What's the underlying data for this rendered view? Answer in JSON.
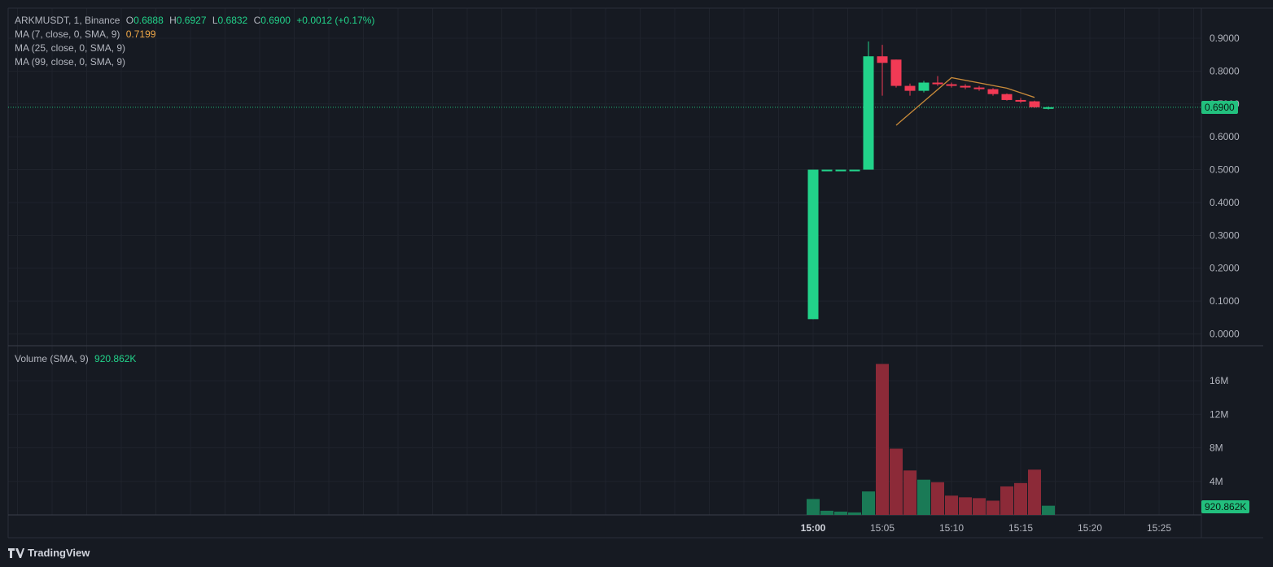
{
  "legend": {
    "symbol": "ARKMUSDT, 1, Binance",
    "o_label": "O",
    "o": "0.6888",
    "h_label": "H",
    "h": "0.6927",
    "l_label": "L",
    "l": "0.6832",
    "c_label": "C",
    "c": "0.6900",
    "change": "+0.0012 (+0.17%)",
    "ma7_label": "MA (7, close, 0, SMA, 9)",
    "ma7_value": "0.7199",
    "ma25_label": "MA (25, close, 0, SMA, 9)",
    "ma99_label": "MA (99, close, 0, SMA, 9)",
    "volume_label": "Volume (SMA, 9)",
    "volume_value": "920.862K"
  },
  "price_tag": "0.6900",
  "volume_tag": "920.862K",
  "brand": "TradingView",
  "colors": {
    "up": "#22d38a",
    "down": "#f23a55",
    "vol_up": "#1a7a56",
    "vol_down": "#8c2a38",
    "ma7": "#c98b3a",
    "bg": "#161a22"
  },
  "chart_data": {
    "type": "candlestick",
    "price_axis": {
      "ticks": [
        "0.9000",
        "0.8000",
        "0.7000",
        "0.6000",
        "0.5000",
        "0.4000",
        "0.3000",
        "0.2000",
        "0.1000",
        "0.0000"
      ],
      "ylim": [
        0,
        0.9
      ]
    },
    "volume_axis": {
      "ticks": [
        "16M",
        "12M",
        "8M",
        "4M"
      ],
      "unit": "M"
    },
    "time_axis": {
      "ticks": [
        "15:00",
        "15:05",
        "15:10",
        "15:15",
        "15:20",
        "15:25"
      ],
      "bold": "15:00"
    },
    "candles": [
      {
        "t": "15:00",
        "o": 0.045,
        "h": 0.5,
        "l": 0.045,
        "c": 0.5,
        "v": 1.9
      },
      {
        "t": "15:01",
        "o": 0.5,
        "h": 0.5,
        "l": 0.5,
        "c": 0.5,
        "v": 0.5
      },
      {
        "t": "15:02",
        "o": 0.5,
        "h": 0.5,
        "l": 0.5,
        "c": 0.5,
        "v": 0.4
      },
      {
        "t": "15:03",
        "o": 0.5,
        "h": 0.5,
        "l": 0.5,
        "c": 0.5,
        "v": 0.3
      },
      {
        "t": "15:04",
        "o": 0.5,
        "h": 0.89,
        "l": 0.5,
        "c": 0.845,
        "v": 2.8
      },
      {
        "t": "15:05",
        "o": 0.845,
        "h": 0.88,
        "l": 0.725,
        "c": 0.825,
        "v": 18.0
      },
      {
        "t": "15:06",
        "o": 0.835,
        "h": 0.835,
        "l": 0.75,
        "c": 0.755,
        "v": 7.9
      },
      {
        "t": "15:07",
        "o": 0.755,
        "h": 0.762,
        "l": 0.725,
        "c": 0.74,
        "v": 5.3
      },
      {
        "t": "15:08",
        "o": 0.74,
        "h": 0.77,
        "l": 0.735,
        "c": 0.765,
        "v": 4.2
      },
      {
        "t": "15:09",
        "o": 0.765,
        "h": 0.785,
        "l": 0.755,
        "c": 0.76,
        "v": 3.9
      },
      {
        "t": "15:10",
        "o": 0.76,
        "h": 0.765,
        "l": 0.75,
        "c": 0.755,
        "v": 2.3
      },
      {
        "t": "15:11",
        "o": 0.755,
        "h": 0.76,
        "l": 0.745,
        "c": 0.75,
        "v": 2.1
      },
      {
        "t": "15:12",
        "o": 0.75,
        "h": 0.755,
        "l": 0.74,
        "c": 0.745,
        "v": 2.0
      },
      {
        "t": "15:13",
        "o": 0.745,
        "h": 0.748,
        "l": 0.725,
        "c": 0.73,
        "v": 1.7
      },
      {
        "t": "15:14",
        "o": 0.73,
        "h": 0.732,
        "l": 0.71,
        "c": 0.712,
        "v": 3.4
      },
      {
        "t": "15:15",
        "o": 0.712,
        "h": 0.718,
        "l": 0.703,
        "c": 0.708,
        "v": 3.8
      },
      {
        "t": "15:16",
        "o": 0.708,
        "h": 0.71,
        "l": 0.688,
        "c": 0.69,
        "v": 5.4
      },
      {
        "t": "15:17",
        "o": 0.6888,
        "h": 0.6927,
        "l": 0.6832,
        "c": 0.69,
        "v": 1.1
      }
    ],
    "ma7": [
      {
        "t": "15:06",
        "v": 0.635
      },
      {
        "t": "15:10",
        "v": 0.78
      },
      {
        "t": "15:14",
        "v": 0.748
      },
      {
        "t": "15:16",
        "v": 0.72
      }
    ],
    "last_price": 0.69
  }
}
